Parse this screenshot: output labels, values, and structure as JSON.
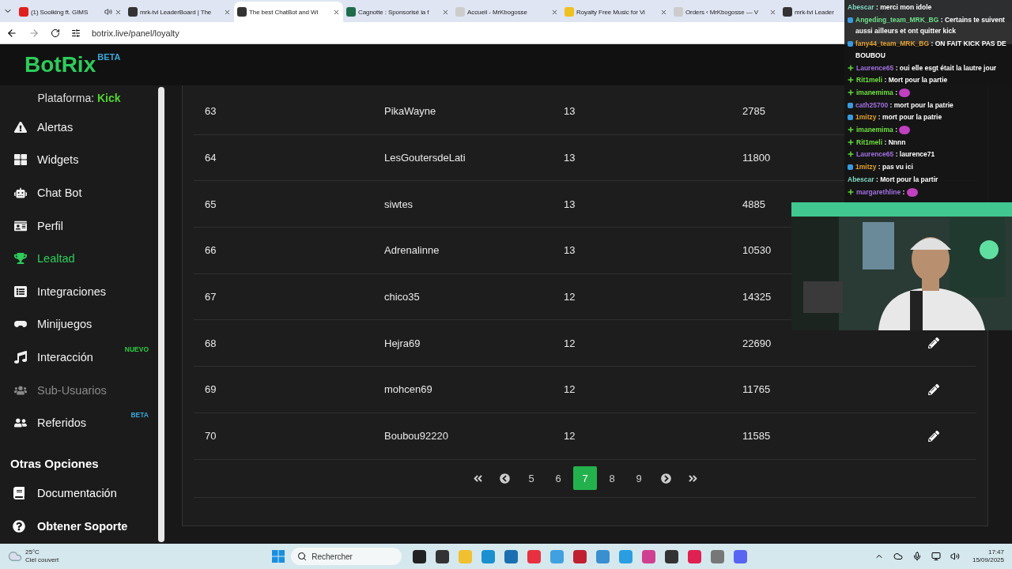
{
  "browser": {
    "tabs": [
      {
        "title": "(1) Soolking ft. GIMS",
        "selected": false,
        "audio": true,
        "color": "#e02020"
      },
      {
        "title": "mrk-tvi LeaderBoard | The",
        "selected": false,
        "audio": false,
        "color": "#333333"
      },
      {
        "title": "The best ChatBot and Wi",
        "selected": true,
        "audio": false,
        "color": "#333333"
      },
      {
        "title": "Cagnotte : Sponsorisé la f",
        "selected": false,
        "audio": false,
        "color": "#1f6b4a"
      },
      {
        "title": "Accueil - MrKbogosse",
        "selected": false,
        "audio": false,
        "color": "#cccccc"
      },
      {
        "title": "Royalty Free Music for Vi",
        "selected": false,
        "audio": false,
        "color": "#f0c020"
      },
      {
        "title": "Orders ‹ MrKbogosse — V",
        "selected": false,
        "audio": false,
        "color": "#cccccc"
      },
      {
        "title": "mrk-tvi Leader",
        "selected": false,
        "audio": false,
        "color": "#333333"
      }
    ],
    "url": "botrix.live/panel/loyalty"
  },
  "header": {
    "logo": "BotRix",
    "badge": "BETA"
  },
  "sidebar": {
    "platform_label": "Plataforma:",
    "platform": "Kick",
    "items": [
      {
        "label": "Alertas",
        "selected": false,
        "disabled": false
      },
      {
        "label": "Widgets",
        "selected": false,
        "disabled": false
      },
      {
        "label": "Chat Bot",
        "selected": false,
        "disabled": false
      },
      {
        "label": "Perfil",
        "selected": false,
        "disabled": false
      },
      {
        "label": "Lealtad",
        "selected": true,
        "disabled": false
      },
      {
        "label": "Integraciones",
        "selected": false,
        "disabled": false
      },
      {
        "label": "Minijuegos",
        "selected": false,
        "disabled": false
      },
      {
        "label": "Interacción",
        "selected": false,
        "disabled": false,
        "badge": "NUEVO",
        "color": "#2ecc40"
      },
      {
        "label": "Sub-Usuarios",
        "selected": false,
        "disabled": true
      },
      {
        "label": "Referidos",
        "selected": false,
        "disabled": false,
        "badge": "BETA",
        "color": "#3aa7d8"
      }
    ],
    "section_title": "Otras Opciones",
    "other_items": [
      {
        "label": "Documentación"
      },
      {
        "label": "Obtener Soporte"
      }
    ]
  },
  "table": {
    "rows": [
      {
        "cells": [
          "63",
          "PikaWayne",
          "13",
          "2785"
        ],
        "edit_button": false
      },
      {
        "cells": [
          "64",
          "LesGoutersdeLati",
          "13",
          "11800"
        ],
        "edit_button": false
      },
      {
        "cells": [
          "65",
          "siwtes",
          "13",
          "4885"
        ],
        "edit_button": false
      },
      {
        "cells": [
          "66",
          "Adrenalinne",
          "13",
          "10530"
        ],
        "edit_button": false
      },
      {
        "cells": [
          "67",
          "chico35",
          "12",
          "14325"
        ],
        "edit_button": false
      },
      {
        "cells": [
          "68",
          "Hejra69",
          "12",
          "22690"
        ],
        "edit_button": true
      },
      {
        "cells": [
          "69",
          "mohcen69",
          "12",
          "11765"
        ],
        "edit_button": true
      },
      {
        "cells": [
          "70",
          "Boubou92220",
          "12",
          "11585"
        ],
        "edit_button": true
      }
    ],
    "pagination": [
      {
        "kind": "first",
        "selected": false
      },
      {
        "kind": "prev",
        "selected": false
      },
      {
        "kind": "page",
        "label": "5",
        "selected": false
      },
      {
        "kind": "page",
        "label": "6",
        "selected": false
      },
      {
        "kind": "page",
        "label": "7",
        "selected": true
      },
      {
        "kind": "page",
        "label": "8",
        "selected": false
      },
      {
        "kind": "page",
        "label": "9",
        "selected": false
      },
      {
        "kind": "next",
        "selected": false
      },
      {
        "kind": "last",
        "selected": false
      }
    ]
  },
  "chat": {
    "messages": [
      {
        "kind": "plain",
        "user": "Abescar",
        "text": ": merci mon idole",
        "color": "#7fd6c0"
      },
      {
        "kind": "badges",
        "user": "Angeding_team_MRK_BG",
        "text": ": Certains te suivent aussi ailleurs et ont quitter kick",
        "color": "#6fe08a"
      },
      {
        "kind": "badges",
        "user": "fany44_team_MRK_BG",
        "text": ": ON FAIT KICK PAS DE BOUBOU",
        "color": "#e0a030"
      },
      {
        "kind": "plus",
        "user": "Laurence65",
        "text": ": oui elle esgt était la lautre jour",
        "color": "#a070e0"
      },
      {
        "kind": "plus",
        "user": "Rit1meli",
        "text": ": Mort pour la partie",
        "color": "#6fe040"
      },
      {
        "kind": "emote",
        "user": "imanemima",
        "text": ":",
        "color": "#6fe040"
      },
      {
        "kind": "badges",
        "user": "cath25700",
        "text": ": mort pour la patrie",
        "color": "#a070e0"
      },
      {
        "kind": "badges",
        "user": "1mitzy",
        "text": ": mort pour la patrie",
        "color": "#e0a030"
      },
      {
        "kind": "emote",
        "user": "imanemima",
        "text": ":",
        "color": "#6fe040"
      },
      {
        "kind": "plus",
        "user": "Rit1meli",
        "text": ": Nnnn",
        "color": "#6fe040"
      },
      {
        "kind": "plus",
        "user": "Laurence65",
        "text": ": laurence71",
        "color": "#a070e0"
      },
      {
        "kind": "badges",
        "user": "1mitzy",
        "text": ": pas vu ici",
        "color": "#e0a030"
      },
      {
        "kind": "plain",
        "user": "Abescar",
        "text": ": Mort pour la partir",
        "color": "#7fd6c0"
      },
      {
        "kind": "emote",
        "user": "margarethline",
        "text": ":",
        "color": "#a070e0"
      }
    ]
  },
  "taskbar": {
    "temperature": "25°C",
    "weather": "Ciel couvert",
    "search_placeholder": "Rechercher",
    "time": "17:47",
    "date": "15/09/2025"
  }
}
